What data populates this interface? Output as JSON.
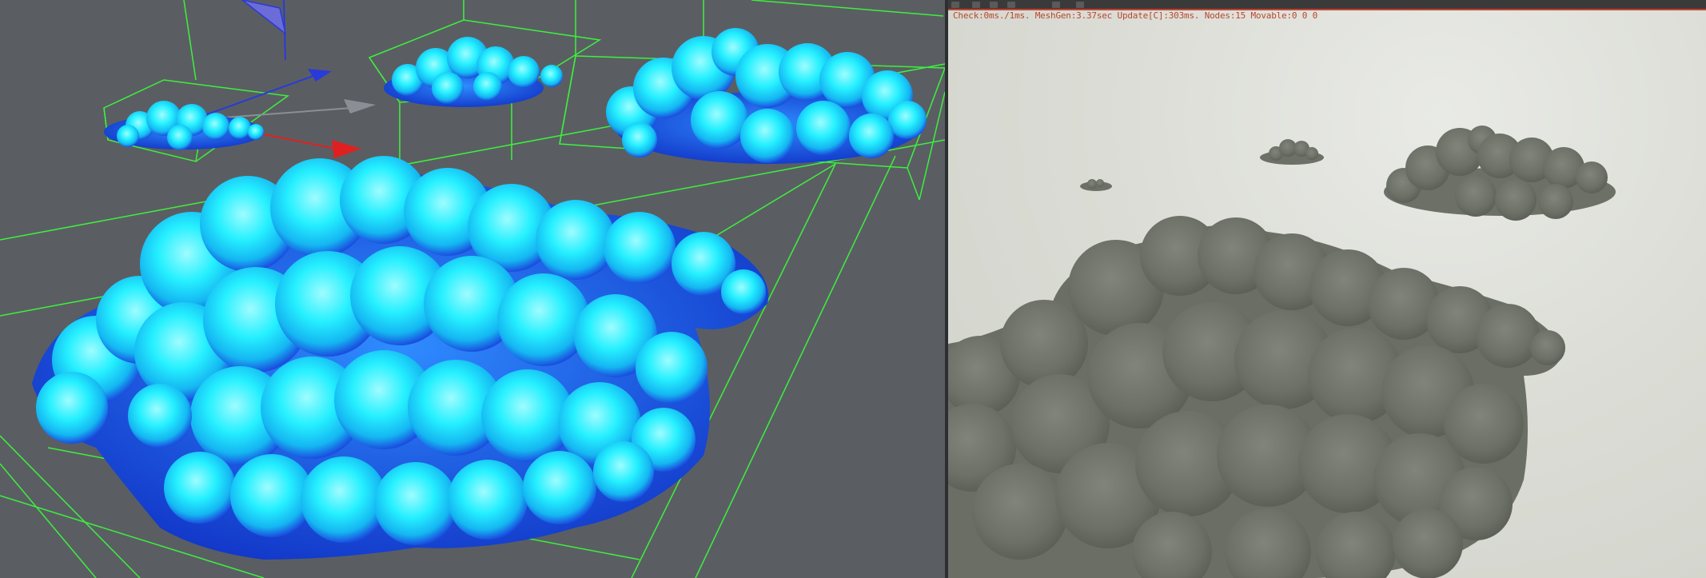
{
  "left_viewport": {
    "colors": {
      "background": "#5a5e63",
      "grid_line": "#3df03d",
      "cloud_light": "#22f0ff",
      "cloud_dark": "#1a4fe0",
      "axis_x": "#e02020",
      "axis_y": "#2a3ad8",
      "axis_z": "#8a8f96"
    },
    "icons": [
      "gizmo-x-arrow-icon",
      "gizmo-y-arrow-icon",
      "gizmo-z-arrow-icon",
      "gizmo-plane-icon"
    ]
  },
  "right_viewport": {
    "stats_text": "Check:0ms./1ms. MeshGen:3.37sec Update[C]:303ms. Nodes:15 Movable:0  0 0",
    "colors": {
      "sky": "#dcddd6",
      "cloud": "#6e7268",
      "stats": "#b8472e",
      "toolbar": "#3a3a3a",
      "toolbar_accent": "#c8432e"
    }
  }
}
